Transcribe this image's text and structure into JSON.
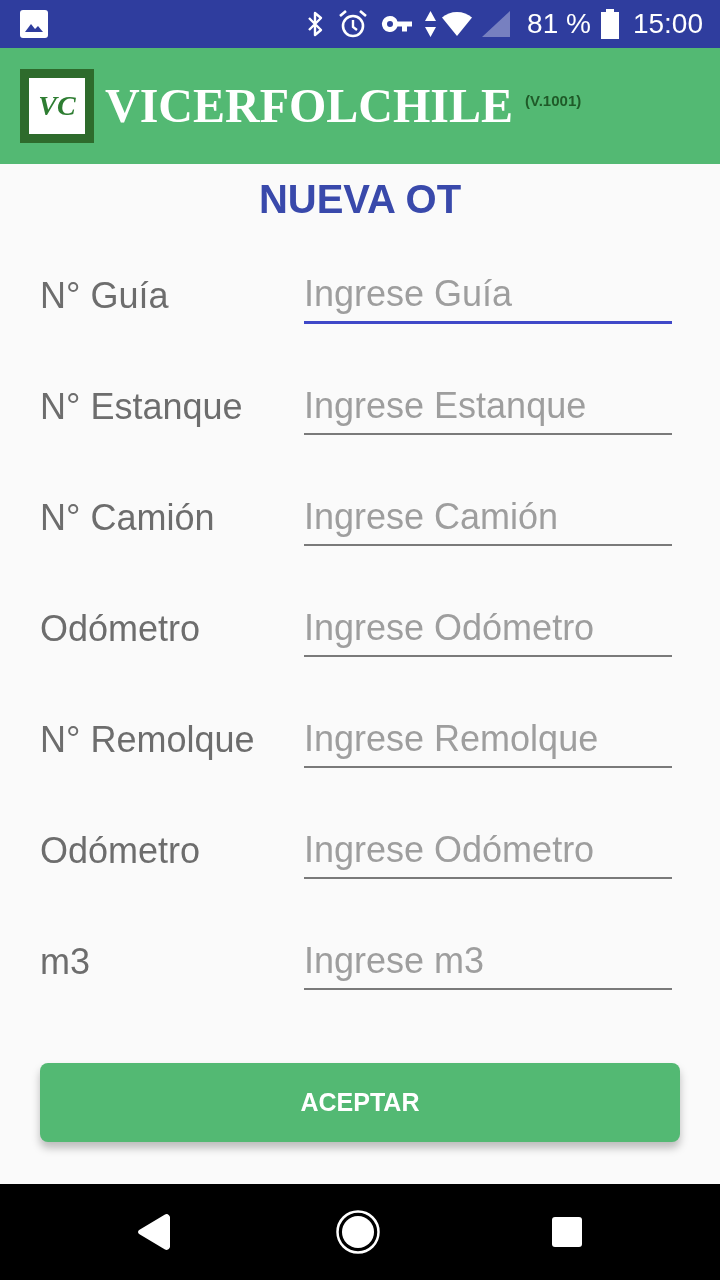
{
  "status_bar": {
    "battery": "81 %",
    "time": "15:00"
  },
  "header": {
    "logo": "VC",
    "title": "VICERFOLCHILE",
    "version": "(V.1001)"
  },
  "form": {
    "title": "NUEVA OT",
    "fields": [
      {
        "label": "N° Guía",
        "placeholder": "Ingrese Guía",
        "focused": true
      },
      {
        "label": "N° Estanque",
        "placeholder": "Ingrese Estanque",
        "focused": false
      },
      {
        "label": "N° Camión",
        "placeholder": "Ingrese Camión",
        "focused": false
      },
      {
        "label": "Odómetro",
        "placeholder": "Ingrese Odómetro",
        "focused": false
      },
      {
        "label": "N° Remolque",
        "placeholder": "Ingrese Remolque",
        "focused": false
      },
      {
        "label": "Odómetro",
        "placeholder": "Ingrese Odómetro",
        "focused": false
      },
      {
        "label": "m3",
        "placeholder": "Ingrese m3",
        "focused": false
      }
    ]
  },
  "button": {
    "label": "ACEPTAR"
  }
}
